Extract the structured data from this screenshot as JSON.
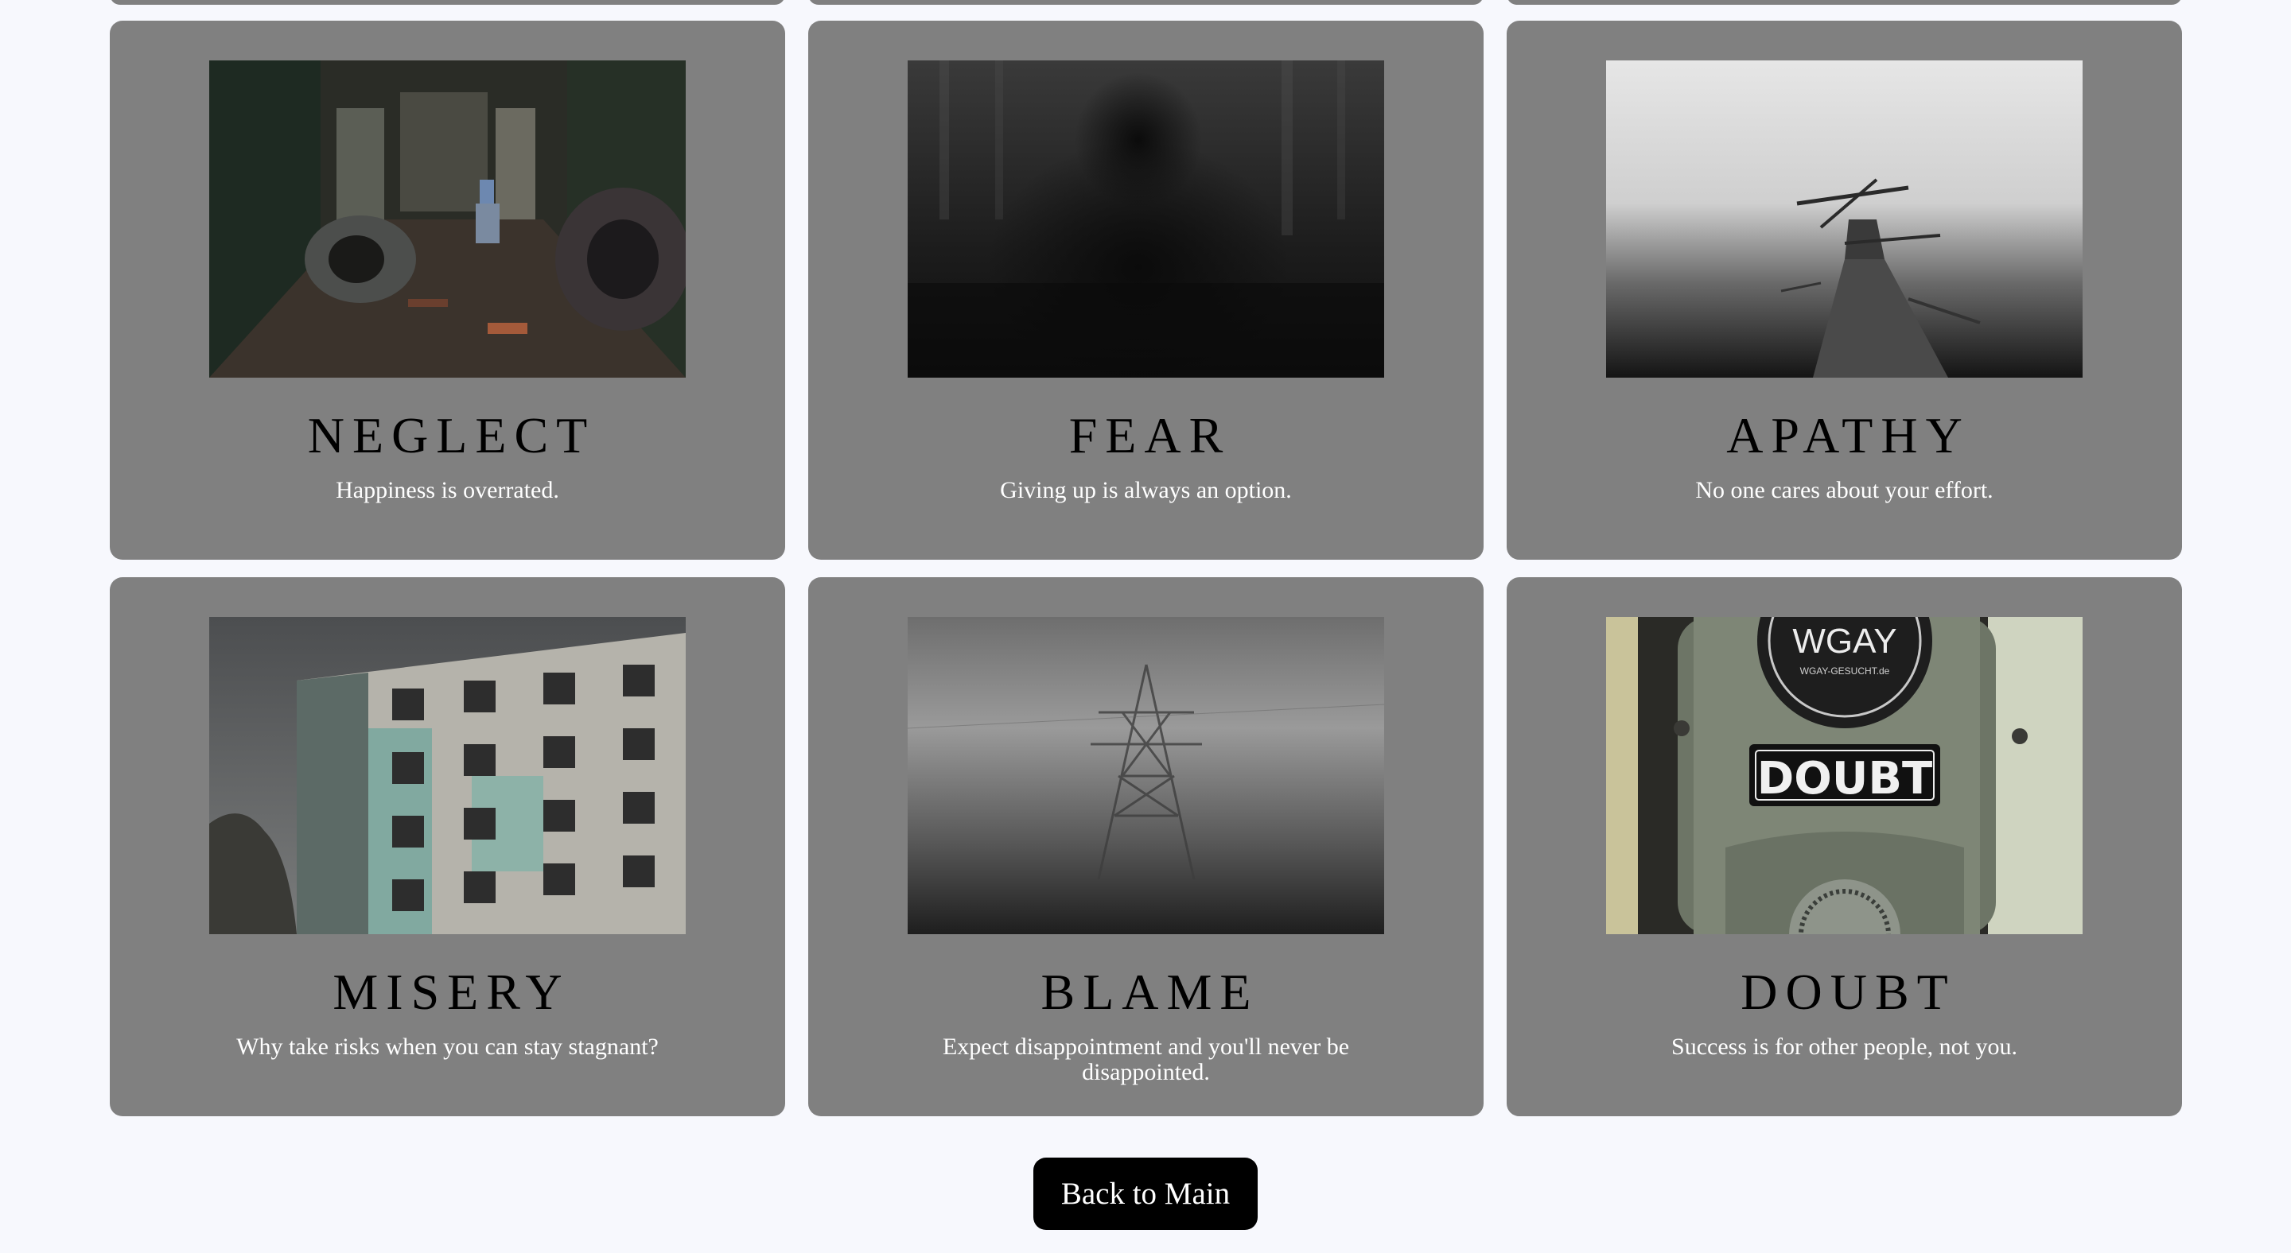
{
  "cards": [
    {
      "title": "NEGLECT",
      "tagline": "Happiness is overrated.",
      "image": "abandoned-factory-photo"
    },
    {
      "title": "FEAR",
      "tagline": "Giving up is always an option.",
      "image": "shadow-figure-photo"
    },
    {
      "title": "APATHY",
      "tagline": "No one cares about your effort.",
      "image": "broken-pier-fog-photo"
    },
    {
      "title": "MISERY",
      "tagline": "Why take risks when you can stay stagnant?",
      "image": "ruined-building-photo"
    },
    {
      "title": "BLAME",
      "tagline": "Expect disappointment and you'll never be disappointed.",
      "image": "power-pylon-fog-photo"
    },
    {
      "title": "DOUBT",
      "tagline": "Success is for other people, not you.",
      "image": "doubt-sticker-photo"
    }
  ],
  "doubt_photo": {
    "sticker_top": "WGAY",
    "sticker_sub": "WGAY-GESUCHT.de",
    "sticker_main": "DOUBT"
  },
  "back_button": {
    "label": "Back to Main"
  },
  "colors": {
    "page_bg": "#f7f8fd",
    "card_bg": "#808080",
    "button_bg": "#000000"
  }
}
